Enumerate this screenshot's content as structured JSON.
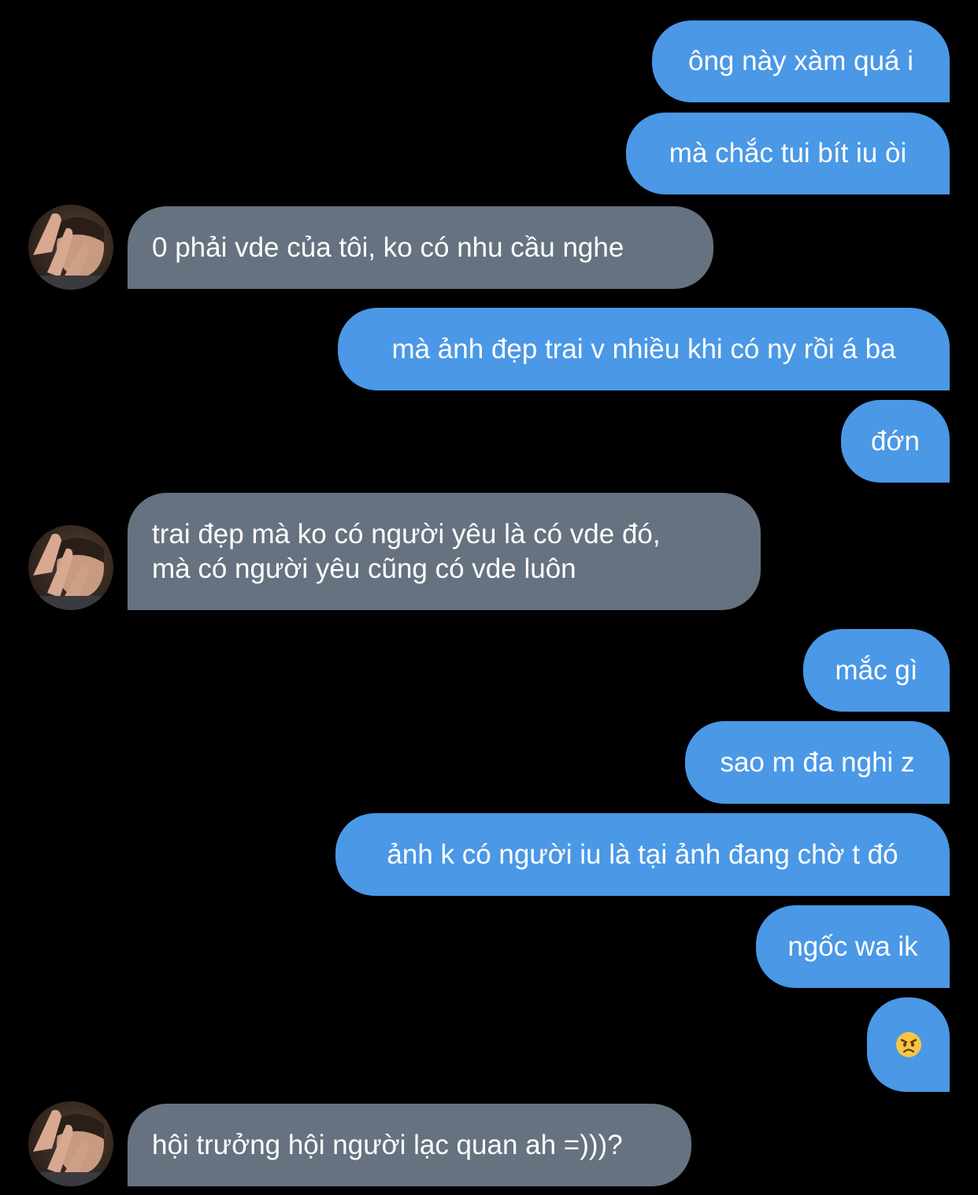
{
  "theme": {
    "background": "#000000",
    "outgoing_bubble": "#4a98e6",
    "incoming_bubble": "#66727f",
    "text_color": "#ffffff"
  },
  "contact": {
    "avatar_icon": "profile-photo-hand-over-face"
  },
  "messages": [
    {
      "direction": "outgoing",
      "text": "ông này xàm quá i"
    },
    {
      "direction": "outgoing",
      "text": "mà chắc tui bít iu òi"
    },
    {
      "direction": "incoming",
      "text": "0 phải vde của tôi, ko có nhu cầu nghe"
    },
    {
      "direction": "outgoing",
      "text": "mà ảnh đẹp trai v nhiều khi có ny rồi á ba"
    },
    {
      "direction": "outgoing",
      "text": "đớn"
    },
    {
      "direction": "incoming",
      "lines": [
        "trai đẹp mà ko có người yêu là có vde đó,",
        "mà có người yêu cũng có vde luôn"
      ]
    },
    {
      "direction": "outgoing",
      "text": "mắc gì"
    },
    {
      "direction": "outgoing",
      "text": "sao m đa nghi z"
    },
    {
      "direction": "outgoing",
      "text": "ảnh k có người iu là tại ảnh đang chờ t đó"
    },
    {
      "direction": "outgoing",
      "text": "ngốc wa ik"
    },
    {
      "direction": "outgoing",
      "emoji": "angry-face-emoji"
    },
    {
      "direction": "incoming",
      "text": "hội trưởng hội người lạc quan ah =)))?"
    }
  ]
}
